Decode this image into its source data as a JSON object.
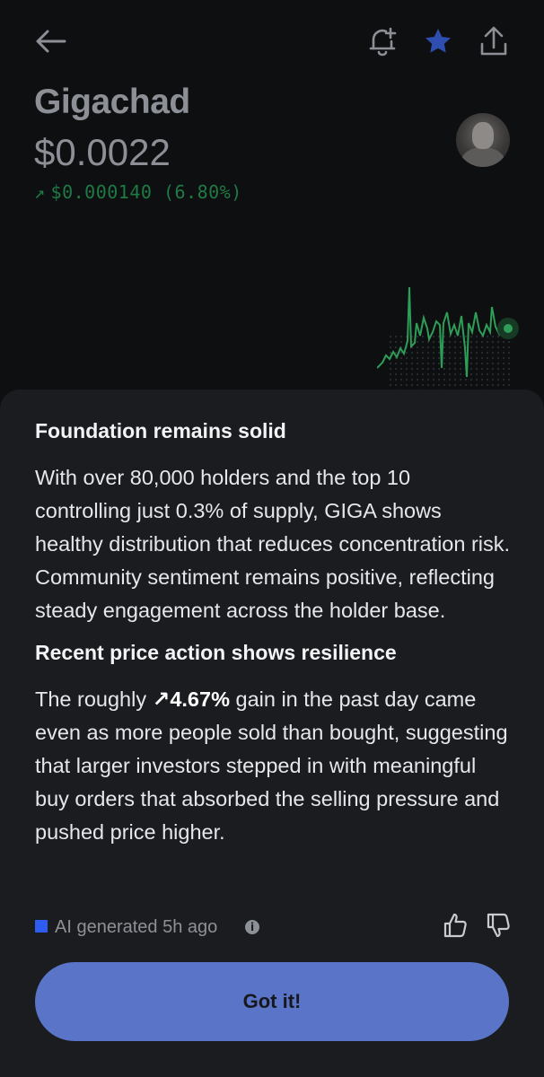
{
  "coin": {
    "name": "Gigachad",
    "price": "$0.0022",
    "change_arrow": "↗",
    "change": "$0.000140 (6.80%)"
  },
  "icons": {
    "back": "back-arrow-icon",
    "alert": "bell-plus-icon",
    "favorite": "star-icon",
    "share": "share-icon"
  },
  "colors": {
    "accent_blue": "#2f5cf0",
    "positive_green": "#1f7a44",
    "button": "#5a74c8",
    "sheet_bg": "#1b1c1f"
  },
  "sheet": {
    "sections": [
      {
        "heading": "Foundation remains solid",
        "body": "With over 80,000 holders and the top 10 controlling just 0.3% of supply, GIGA shows healthy distribution that reduces concentration risk. Community sentiment remains positive, reflecting steady engagement across the holder base."
      },
      {
        "heading": "Recent price action shows resilience",
        "body_before": "The roughly ",
        "gain": "↗4.67%",
        "body_after": " gain in the past day came even as more people sold than bought, suggesting that larger investors stepped in with meaningful buy orders that absorbed the selling pressure and pushed price higher."
      }
    ],
    "footer": {
      "ai_label": "AI generated 5h ago",
      "info": "i"
    },
    "button_label": "Got it!"
  }
}
